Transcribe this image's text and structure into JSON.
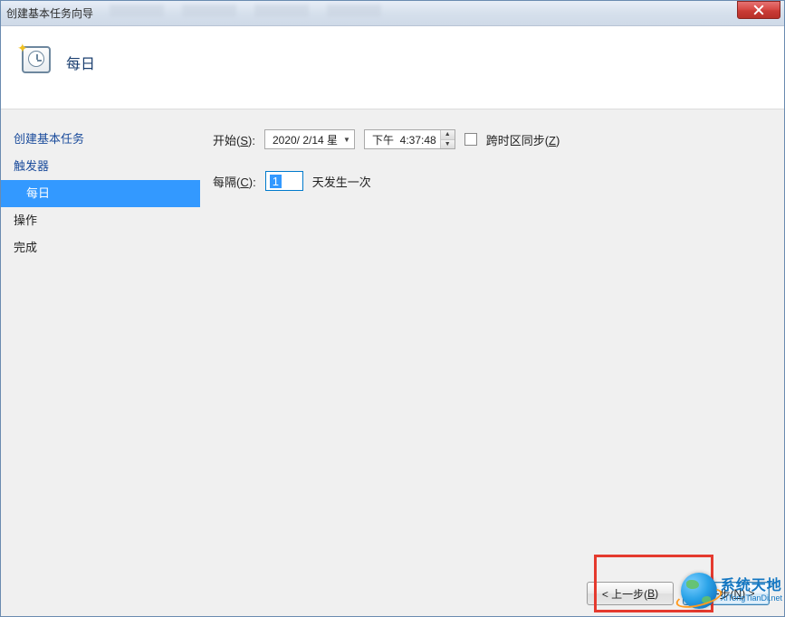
{
  "window": {
    "title": "创建基本任务向导"
  },
  "header": {
    "title": "每日"
  },
  "sidebar": {
    "items": [
      {
        "label": "创建基本任务"
      },
      {
        "label": "触发器"
      },
      {
        "label": "每日"
      },
      {
        "label": "操作"
      },
      {
        "label": "完成"
      }
    ]
  },
  "form": {
    "start_label_pre": "开始(",
    "start_label_key": "S",
    "start_label_post": "):",
    "date_value": "2020/ 2/14 星",
    "time_prefix": "下午",
    "time_value": "4:37:48",
    "sync_label_pre": "跨时区同步(",
    "sync_label_key": "Z",
    "sync_label_post": ")",
    "interval_label_pre": "每隔(",
    "interval_label_key": "C",
    "interval_label_post": "):",
    "interval_value": "1",
    "interval_suffix": "天发生一次"
  },
  "footer": {
    "back_pre": "< 上一步(",
    "back_key": "B",
    "back_post": ")",
    "next_pre": "下一步(",
    "next_key": "N",
    "next_post": ") >"
  },
  "watermark": {
    "cn": "系统天地",
    "en": "XiTongTianDi.net"
  }
}
